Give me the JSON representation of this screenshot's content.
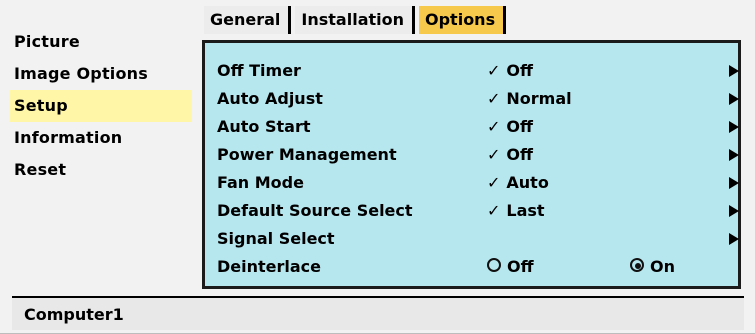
{
  "left_menu": {
    "items": [
      {
        "label": "Picture"
      },
      {
        "label": "Image Options"
      },
      {
        "label": "Setup"
      },
      {
        "label": "Information"
      },
      {
        "label": "Reset"
      }
    ]
  },
  "tabs": [
    {
      "label": "General"
    },
    {
      "label": "Installation"
    },
    {
      "label": "Options"
    }
  ],
  "settings": {
    "off_timer": {
      "label": "Off Timer",
      "check": "✓",
      "value": "Off"
    },
    "auto_adjust": {
      "label": "Auto Adjust",
      "check": "✓",
      "value": "Normal"
    },
    "auto_start": {
      "label": "Auto Start",
      "check": "✓",
      "value": "Off"
    },
    "power_management": {
      "label": "Power Management",
      "check": "✓",
      "value": "Off"
    },
    "fan_mode": {
      "label": "Fan Mode",
      "check": "✓",
      "value": "Auto"
    },
    "default_source_select": {
      "label": "Default Source Select",
      "check": "✓",
      "value": "Last"
    },
    "signal_select": {
      "label": "Signal Select"
    },
    "deinterlace": {
      "label": "Deinterlace",
      "options": [
        {
          "label": "Off",
          "selected": false
        },
        {
          "label": "On",
          "selected": true
        }
      ]
    }
  },
  "status_bar": {
    "source": "Computer1"
  },
  "colors": {
    "panel_bg": "#b6e7ef",
    "active_menu": "#fff6a8",
    "active_tab": "#f6c94c"
  }
}
